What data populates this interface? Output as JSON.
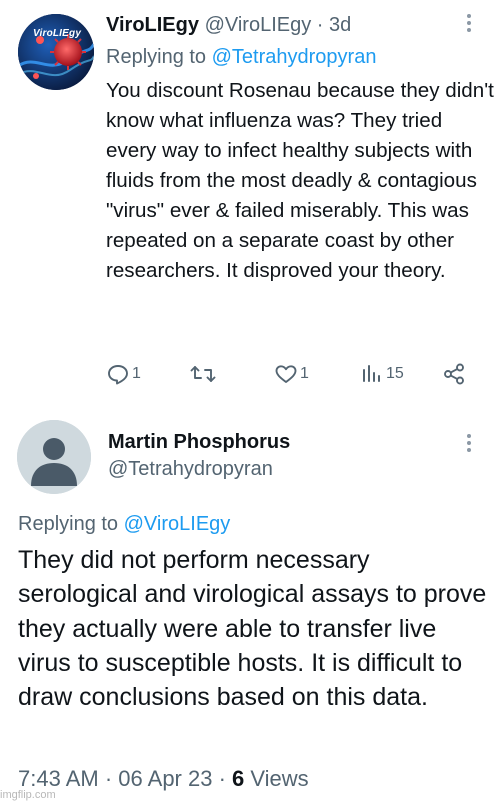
{
  "tweet1": {
    "display_name": "ViroLIEgy",
    "handle": "@ViroLIEgy",
    "separator": " · ",
    "time": "3d",
    "avatar_brand": "ViroLIEgy",
    "replying_label": "Replying to ",
    "replying_to": "@Tetrahydropyran",
    "text": "You discount Rosenau because they didn't know what influenza was? They tried every way to infect healthy subjects with fluids from the most deadly & contagious \"virus\" ever & failed miserably. This was repeated on a separate coast by other researchers. It disproved your theory.",
    "reply_count": "1",
    "retweet_count": "",
    "like_count": "1",
    "view_count": "15"
  },
  "tweet2": {
    "display_name": "Martin Phosphorus",
    "handle": "@Tetrahydropyran",
    "replying_label": "Replying to ",
    "replying_to": "@ViroLIEgy",
    "text": "They did not perform necessary serological and virological assays to prove they actually were able to transfer live virus to susceptible hosts. It is difficult to draw conclusions based on this data.",
    "time": "7:43 AM",
    "separator": " · ",
    "date": "06 Apr 23",
    "views_count": "6",
    "views_label": " Views"
  },
  "watermark": "imgflip.com",
  "colors": {
    "text": "#0f1419",
    "muted": "#536471",
    "link": "#1d9bf0",
    "avatar_placeholder": "#cfd9de"
  }
}
